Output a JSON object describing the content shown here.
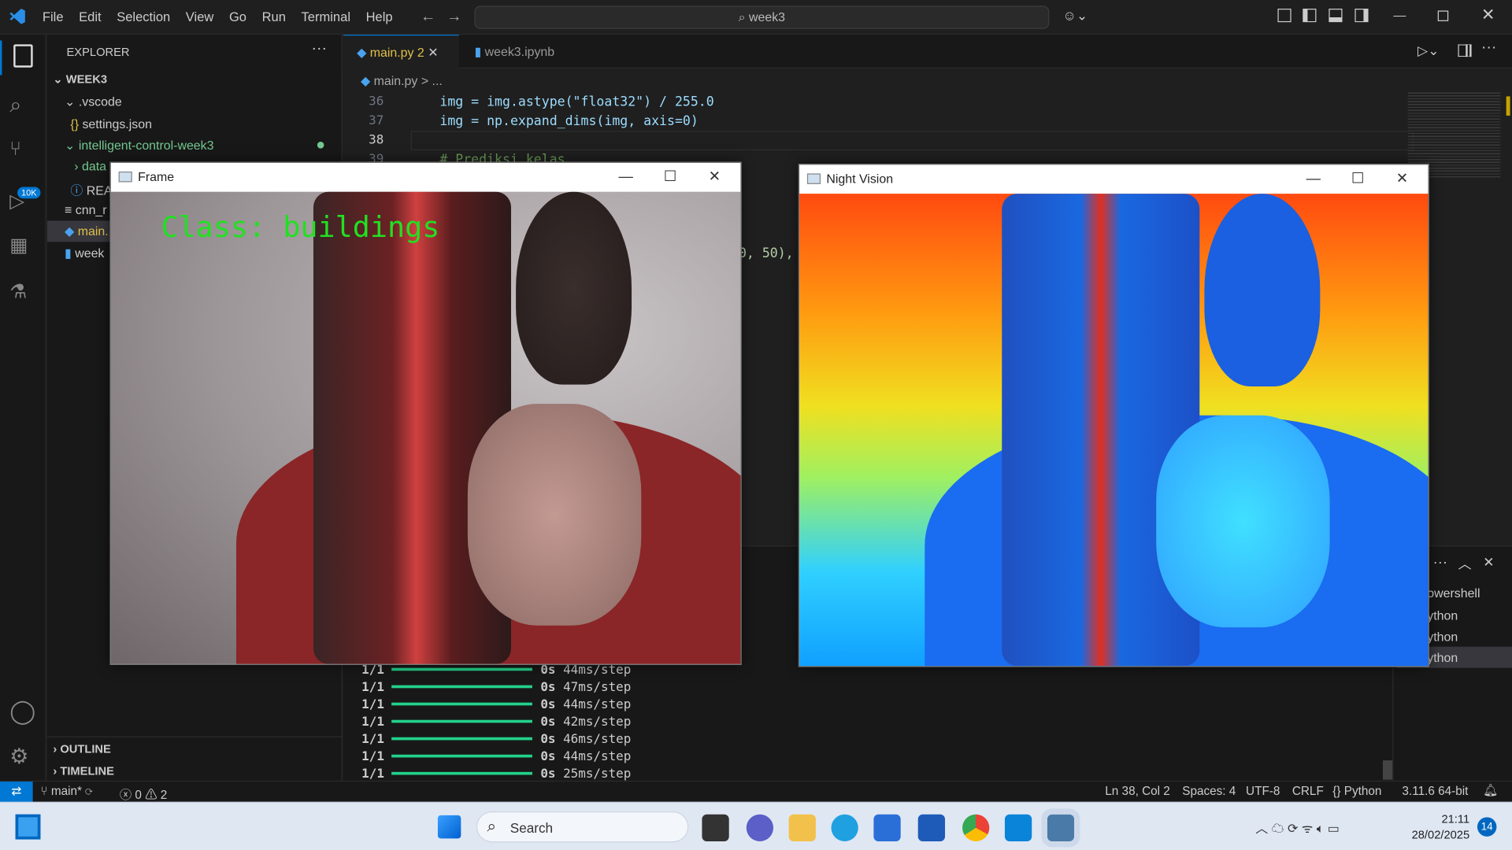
{
  "menu": [
    "File",
    "Edit",
    "Selection",
    "View",
    "Go",
    "Run",
    "Terminal",
    "Help"
  ],
  "command_center": "week3",
  "explorer": {
    "title": "EXPLORER",
    "root": "WEEK3",
    "items": [
      ".vscode",
      "settings.json",
      "intelligent-control-week3",
      "data",
      "REA",
      "cnn_r",
      "main.",
      "week"
    ]
  },
  "outline": "OUTLINE",
  "timeline": "TIMELINE",
  "tabs": [
    {
      "label": "main.py",
      "badge": "2"
    },
    {
      "label": "week3.ipynb"
    }
  ],
  "breadcrumb": [
    "main.py",
    ">",
    "..."
  ],
  "lines": [
    {
      "n": "36",
      "code": "img = img.astype(\"float32\") / 255.0"
    },
    {
      "n": "37",
      "code": "img = np.expand_dims(img, axis=0)"
    },
    {
      "n": "38",
      "code": ""
    },
    {
      "n": "39",
      "code": "# Prediksi kelas"
    }
  ],
  "partial_code": "0, 50),",
  "terminal_rows": [
    {
      "a": "1/1",
      "t": "0s",
      "s": "44ms/step"
    },
    {
      "a": "1/1",
      "t": "0s",
      "s": "47ms/step"
    },
    {
      "a": "1/1",
      "t": "0s",
      "s": "44ms/step"
    },
    {
      "a": "1/1",
      "t": "0s",
      "s": "42ms/step"
    },
    {
      "a": "1/1",
      "t": "0s",
      "s": "46ms/step"
    },
    {
      "a": "1/1",
      "t": "0s",
      "s": "44ms/step"
    },
    {
      "a": "1/1",
      "t": "0s",
      "s": "25ms/step"
    }
  ],
  "terminal_list": [
    "owershell",
    "ython",
    "ython",
    "ython"
  ],
  "frame_window": {
    "title": "Frame",
    "overlay": "Class: buildings"
  },
  "night_window": {
    "title": "Night Vision"
  },
  "status": {
    "branch": "main*",
    "errors": "0",
    "warnings": "2",
    "position": "Ln 38, Col 2",
    "spaces": "Spaces: 4",
    "encoding": "UTF-8",
    "eol": "CRLF",
    "language": "Python",
    "interpreter": "3.11.6 64-bit"
  },
  "taskbar": {
    "search": "Search",
    "time": "21:11",
    "date": "28/02/2025",
    "notif": "14"
  },
  "badge_scm": "10K"
}
